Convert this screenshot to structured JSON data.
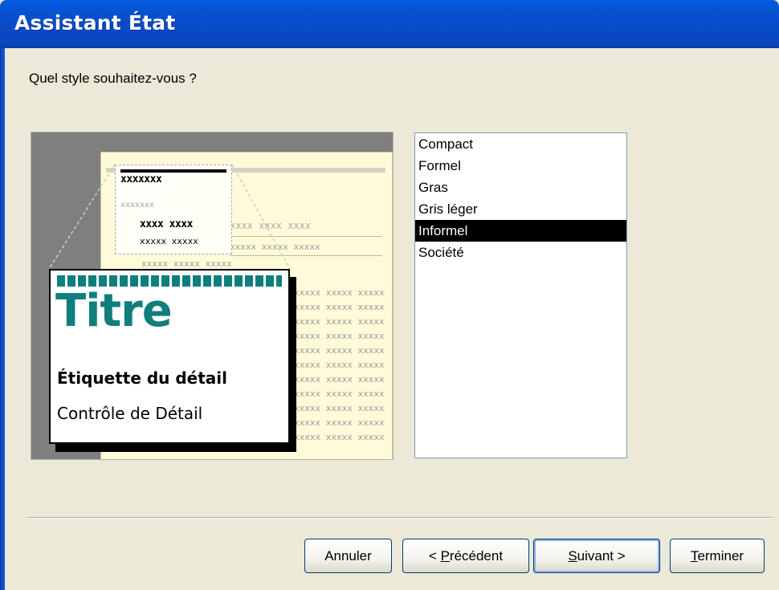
{
  "window": {
    "title": "Assistant État"
  },
  "question": "Quel style souhaitez-vous ?",
  "preview": {
    "mini_title": "xxxxxxx",
    "mini_subtitle": "xxxxxxx",
    "mini_label": "xxxx xxxx",
    "mini_control": "xxxxx xxxxx",
    "label_row_tail": "xxxx xxxx xxxx",
    "data_row": "xxxxx xxxxx xxxxx",
    "card_title": "Titre",
    "card_label": "Étiquette du détail",
    "card_control": "Contrôle de Détail"
  },
  "styles": {
    "items": [
      "Compact",
      "Formel",
      "Gras",
      "Gris léger",
      "Informel",
      "Société"
    ],
    "selected": "Informel"
  },
  "buttons": {
    "cancel": "Annuler",
    "back_prefix": "< ",
    "back_mnemonic": "P",
    "back_rest": "récédent",
    "next_mnemonic": "S",
    "next_rest": "uivant >",
    "finish_mnemonic": "T",
    "finish_rest": "erminer"
  }
}
